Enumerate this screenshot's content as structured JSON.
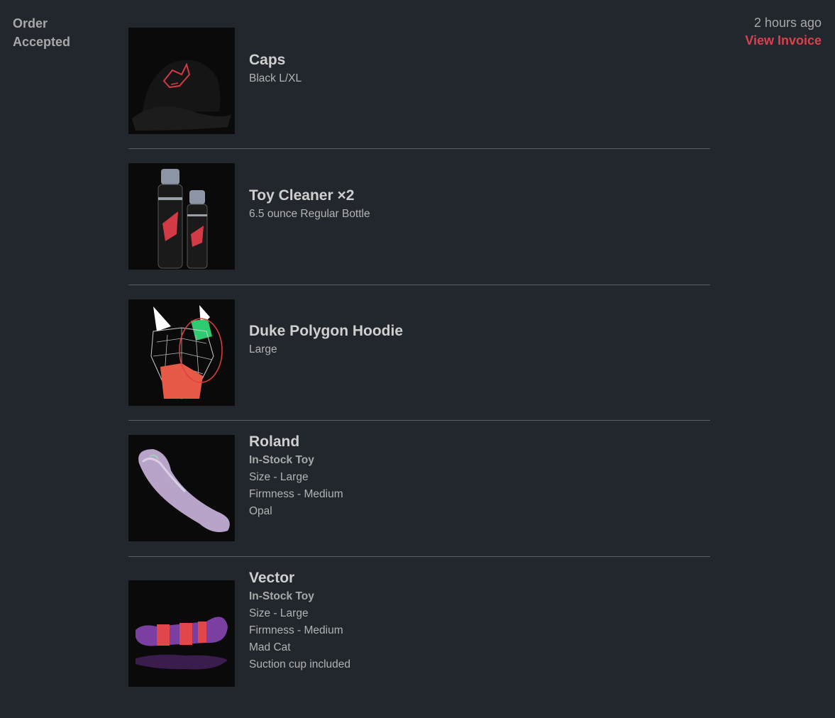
{
  "order": {
    "status": "Order Accepted",
    "time": "2 hours ago",
    "invoice_label": "View Invoice"
  },
  "items": [
    {
      "name": "Caps",
      "details": [
        {
          "text": "Black L/XL",
          "bold": false
        }
      ],
      "image_icon": "black-cap-image"
    },
    {
      "name": "Toy Cleaner ×2",
      "details": [
        {
          "text": "6.5 ounce Regular Bottle",
          "bold": false
        }
      ],
      "image_icon": "cleaner-bottles-image"
    },
    {
      "name": "Duke Polygon Hoodie",
      "details": [
        {
          "text": "Large",
          "bold": false
        }
      ],
      "image_icon": "polygon-wolf-image"
    },
    {
      "name": "Roland",
      "details": [
        {
          "text": "In-Stock Toy",
          "bold": true
        },
        {
          "text": "Size - Large",
          "bold": false
        },
        {
          "text": "Firmness - Medium",
          "bold": false
        },
        {
          "text": "Opal",
          "bold": false
        }
      ],
      "image_icon": "opal-toy-image"
    },
    {
      "name": "Vector",
      "details": [
        {
          "text": "In-Stock Toy",
          "bold": true
        },
        {
          "text": "Size - Large",
          "bold": false
        },
        {
          "text": "Firmness - Medium",
          "bold": false
        },
        {
          "text": "Mad Cat",
          "bold": false
        },
        {
          "text": "Suction cup included",
          "bold": false
        }
      ],
      "image_icon": "mad-cat-toy-image"
    }
  ],
  "colors": {
    "background": "#22262d",
    "accent": "#d9424c",
    "divider": "#5a5d63"
  }
}
